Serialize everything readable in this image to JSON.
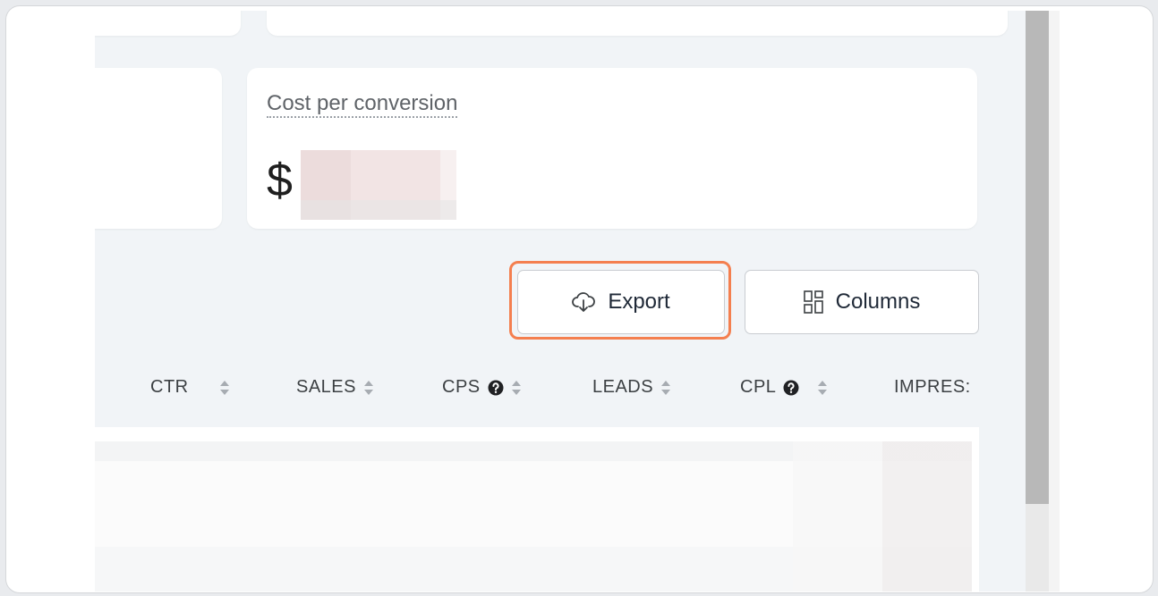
{
  "cost_card": {
    "label": "Cost per conversion",
    "currency_symbol": "$"
  },
  "toolbar": {
    "export_label": "Export",
    "columns_label": "Columns",
    "export_icon": "cloud-download-icon",
    "columns_icon": "grid-columns-icon"
  },
  "table": {
    "columns": [
      {
        "label": "CTR",
        "help": false
      },
      {
        "label": "SALES",
        "help": false
      },
      {
        "label": "CPS",
        "help": true
      },
      {
        "label": "LEADS",
        "help": false
      },
      {
        "label": "CPL",
        "help": true
      },
      {
        "label": "IMPRES:",
        "help": false
      }
    ]
  },
  "colors": {
    "highlight": "#f47f4f",
    "background": "#f1f4f7"
  }
}
